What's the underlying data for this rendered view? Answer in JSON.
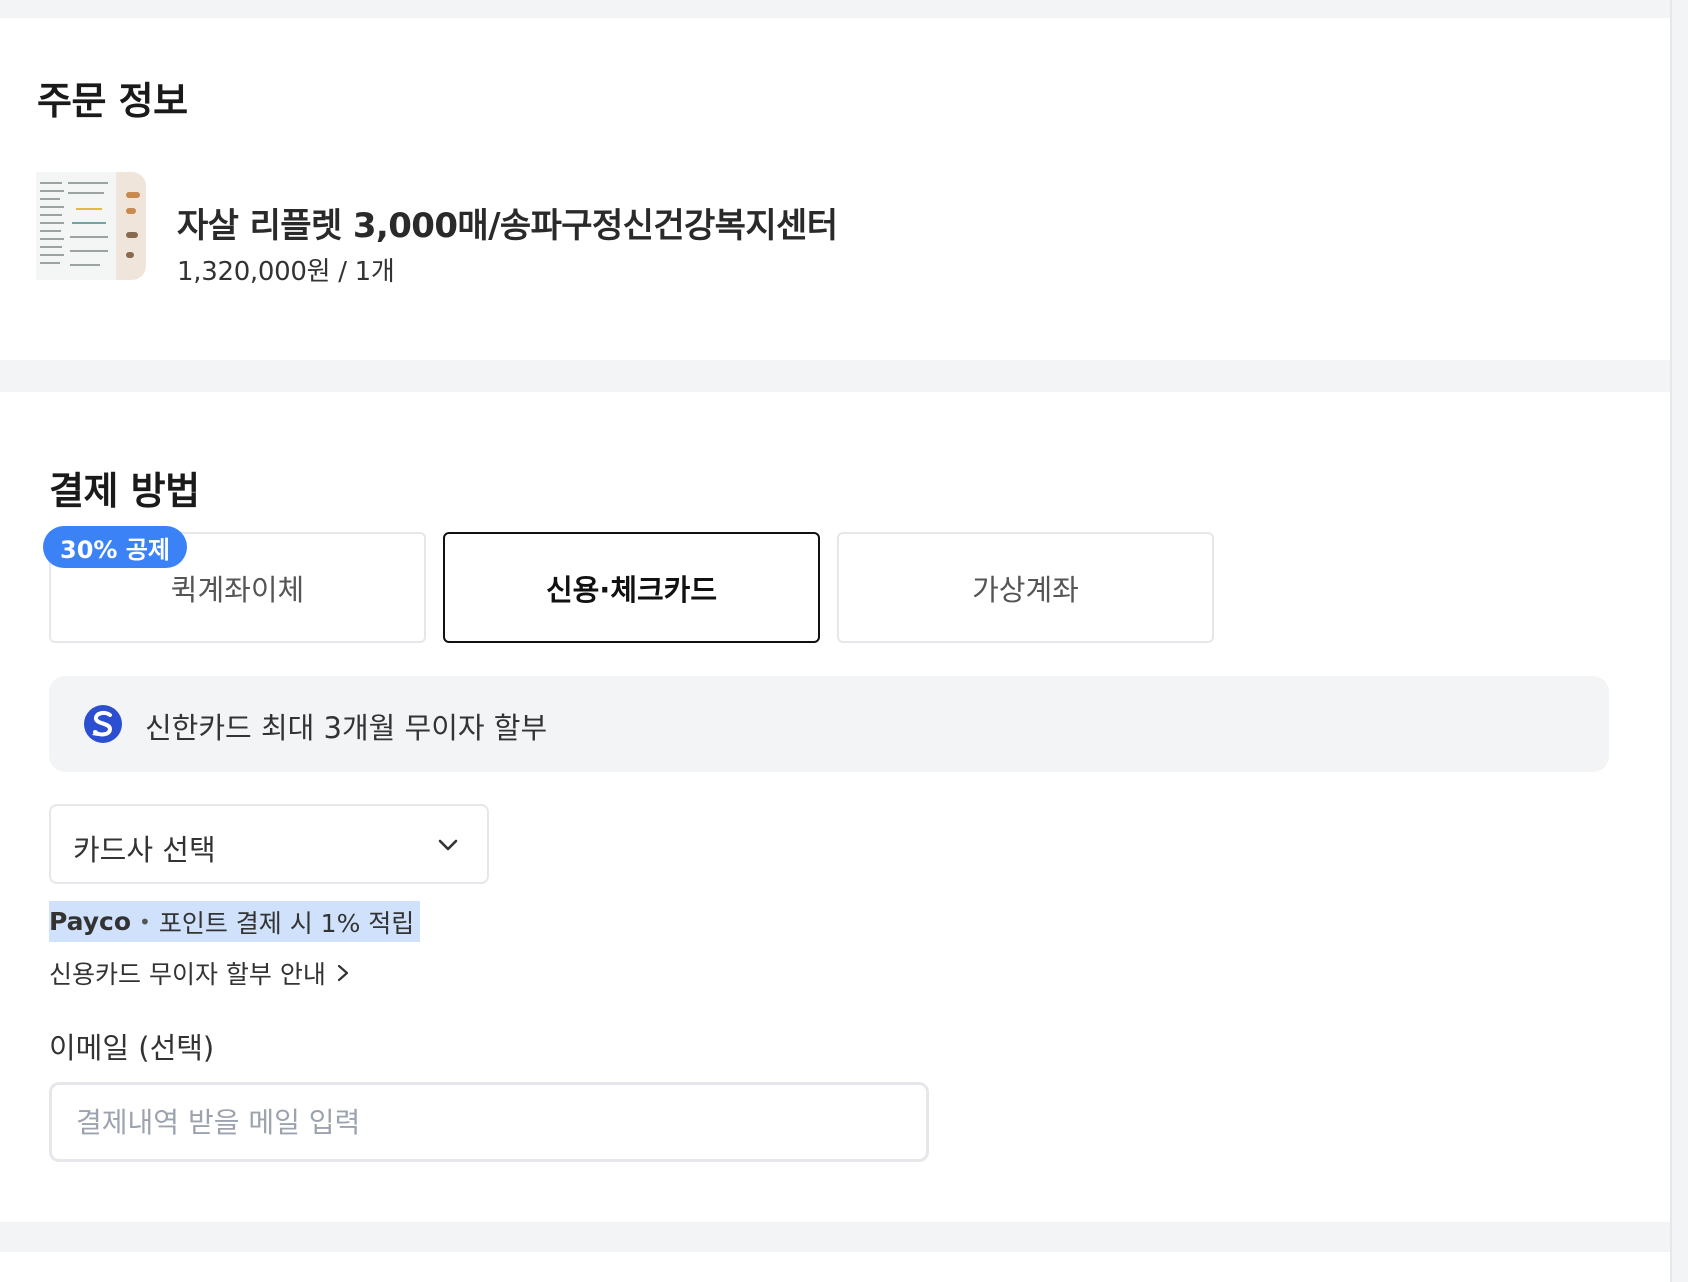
{
  "order": {
    "title": "주문 정보",
    "product_name": "자살 리플렛 3,000매/송파구정신건강복지센터",
    "product_price": "1,320,000원 / 1개"
  },
  "payment": {
    "title": "결제 방법",
    "badge": "30% 공제",
    "methods": [
      {
        "label": "퀵계좌이체",
        "selected": false
      },
      {
        "label": "신용·체크카드",
        "selected": true
      },
      {
        "label": "가상계좌",
        "selected": false
      }
    ],
    "promo": {
      "icon": "shinhan-card-icon",
      "text": "신한카드 최대 3개월 무이자 할부"
    },
    "card_select": {
      "value": "카드사 선택",
      "icon": "chevron-down-icon"
    },
    "payco": {
      "brand": "Payco",
      "separator": "•",
      "text": "포인트 결제 시 1% 적립"
    },
    "installment_link": "신용카드 무이자 할부 안내",
    "email": {
      "label": "이메일 (선택)",
      "placeholder": "결제내역 받을 메일 입력",
      "value": ""
    }
  },
  "colors": {
    "accent": "#3b82f6",
    "selection": "#cfe1fb",
    "brand_shinhan": "#2b4fd0"
  }
}
